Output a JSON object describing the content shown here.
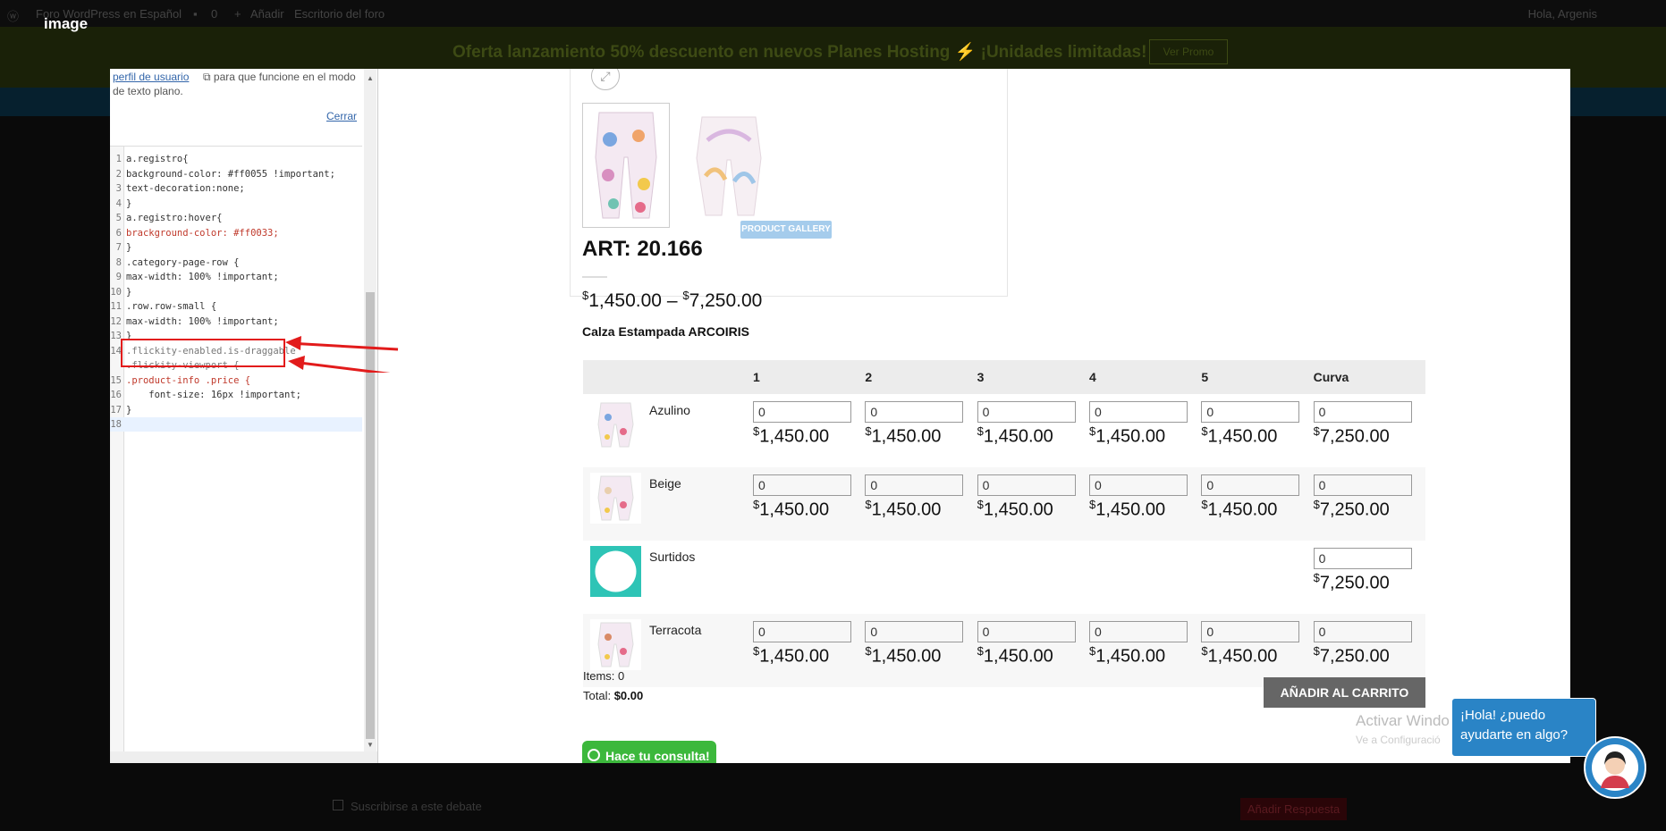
{
  "admin_bar": {
    "site": "Foro WordPress en Español",
    "comments": "0",
    "add": "Añadir",
    "dashboard": "Escritorio del foro",
    "greeting": "Hola, Argenis"
  },
  "promo": {
    "text": "Oferta lanzamiento 50% descuento en nuevos Planes Hosting  ⚡  ¡Unidades limitadas!",
    "button": "Ver Promo"
  },
  "image_caption": "image",
  "editor": {
    "top_link": "perfil de usuario",
    "top_rest": "para que funcione en el modo",
    "top_line2": "de texto plano.",
    "close": "Cerrar",
    "lines": [
      {
        "n": "1",
        "t": "a.registro{"
      },
      {
        "n": "2",
        "t": "background-color: #ff0055 !important;"
      },
      {
        "n": "3",
        "t": "text-decoration:none;"
      },
      {
        "n": "4",
        "t": "}"
      },
      {
        "n": "5",
        "t": "a.registro:hover{"
      },
      {
        "n": "6",
        "t": "brackground-color: #ff0033;"
      },
      {
        "n": "7",
        "t": "}"
      },
      {
        "n": "8",
        "t": ".category-page-row {"
      },
      {
        "n": "9",
        "t": "max-width: 100% !important;"
      },
      {
        "n": "10",
        "t": "}"
      },
      {
        "n": "11",
        "t": ".row.row-small {"
      },
      {
        "n": "12",
        "t": "max-width: 100% !important;"
      },
      {
        "n": "13",
        "t": "}"
      },
      {
        "n": "14",
        "t": ".flickity-enabled.is-draggable"
      },
      {
        "n": "",
        "t": ".flickity-viewport {"
      },
      {
        "n": "15",
        "t": ".product-info .price {"
      },
      {
        "n": "16",
        "t": "    font-size: 16px !important;"
      },
      {
        "n": "17",
        "t": "}"
      },
      {
        "n": "18",
        "t": ""
      }
    ]
  },
  "product": {
    "gallery_badge": "PRODUCT GALLERY",
    "art": "ART: 20.166",
    "price_min_sym": "$",
    "price_min": "1,450.00",
    "price_sep": "–",
    "price_max_sym": "$",
    "price_max": "7,250.00",
    "name": "Calza Estampada ARCOIRIS",
    "columns": [
      "1",
      "2",
      "3",
      "4",
      "5",
      "Curva"
    ],
    "rows": [
      {
        "name": "Azulino",
        "qty": [
          "0",
          "0",
          "0",
          "0",
          "0",
          "0"
        ],
        "price": [
          "1,450.00",
          "1,450.00",
          "1,450.00",
          "1,450.00",
          "1,450.00",
          "7,250.00"
        ]
      },
      {
        "name": "Beige",
        "qty": [
          "0",
          "0",
          "0",
          "0",
          "0",
          "0"
        ],
        "price": [
          "1,450.00",
          "1,450.00",
          "1,450.00",
          "1,450.00",
          "1,450.00",
          "7,250.00"
        ]
      },
      {
        "name": "Surtidos",
        "qty": [
          "0"
        ],
        "price": [
          "7,250.00"
        ]
      },
      {
        "name": "Terracota",
        "qty": [
          "0",
          "0",
          "0",
          "0",
          "0",
          "0"
        ],
        "price": [
          "1,450.00",
          "1,450.00",
          "1,450.00",
          "1,450.00",
          "1,450.00",
          "7,250.00"
        ]
      }
    ],
    "currency": "$",
    "items_label": "Items: 0",
    "total_label": "Total:",
    "total_value": "$0.00",
    "cart_button": "AÑADIR AL CARRITO",
    "consult_button": "Hace tu consulta!"
  },
  "windows_watermark": {
    "line1": "Activar Windo",
    "line2": "Ve a Configuració"
  },
  "chat": {
    "bubble": "¡Hola! ¿puedo ayudarte en algo?"
  },
  "footer": {
    "subscribe": "Suscribirse a este debate",
    "reply": "Añadir Respuesta"
  },
  "colors": {
    "arrow": "#e21b1b",
    "chat": "#2a84c6",
    "cart": "#666666",
    "whatsapp": "#3cb83c",
    "badge": "#a5ccec"
  }
}
